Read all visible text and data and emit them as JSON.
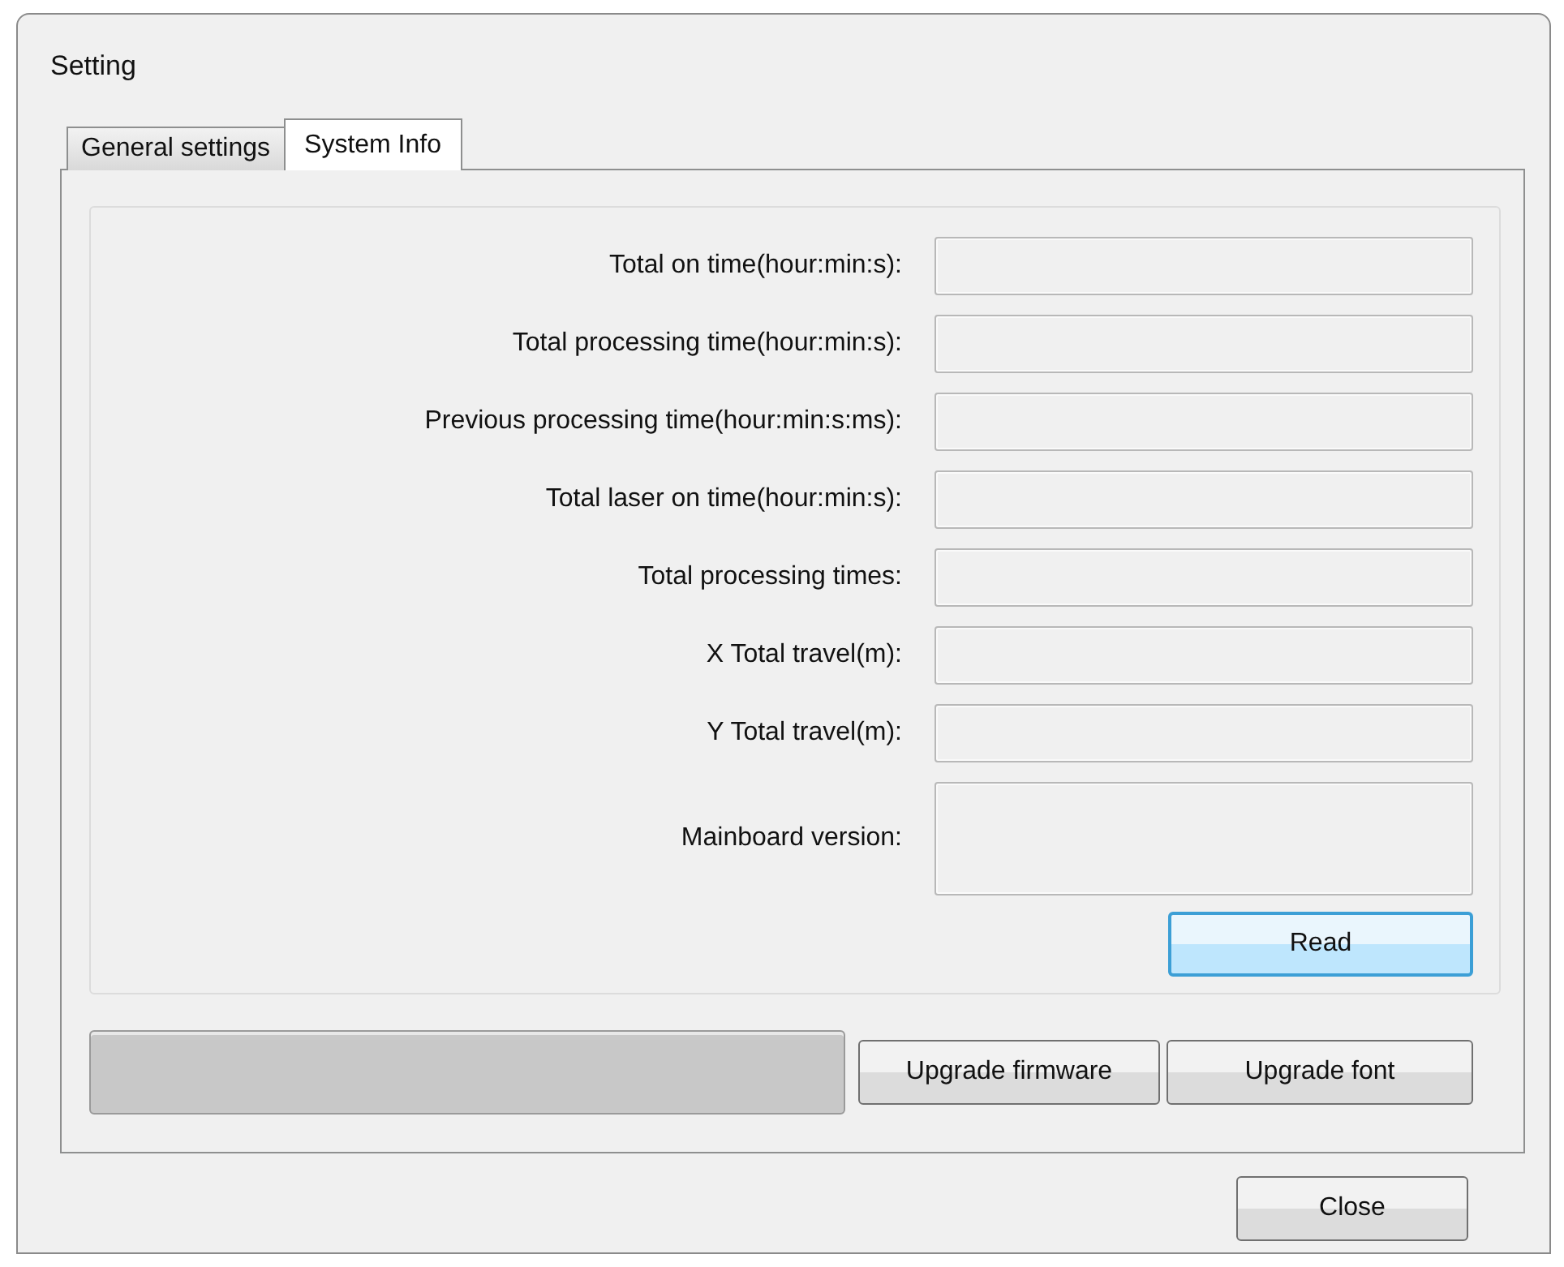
{
  "window": {
    "title": "Setting"
  },
  "tabs": [
    {
      "label": "General settings",
      "selected": false
    },
    {
      "label": "System Info",
      "selected": true
    }
  ],
  "info_fields": [
    {
      "label": "Total on time(hour:min:s):",
      "kind": "single"
    },
    {
      "label": "Total processing time(hour:min:s):",
      "kind": "single"
    },
    {
      "label": "Previous processing time(hour:min:s:ms):",
      "kind": "single"
    },
    {
      "label": "Total laser on time(hour:min:s):",
      "kind": "single"
    },
    {
      "label": "Total processing times:",
      "kind": "single"
    },
    {
      "label": "X Total travel(m):",
      "kind": "single"
    },
    {
      "label": "Y Total travel(m):",
      "kind": "single"
    },
    {
      "label": "Mainboard version:",
      "kind": "multi"
    }
  ],
  "read_button": {
    "label": "Read",
    "focused": true
  },
  "progress": {
    "level": 0
  },
  "upgrade_buttons": [
    "Upgrade firmware",
    "Upgrade font"
  ],
  "close_button": "Close"
}
